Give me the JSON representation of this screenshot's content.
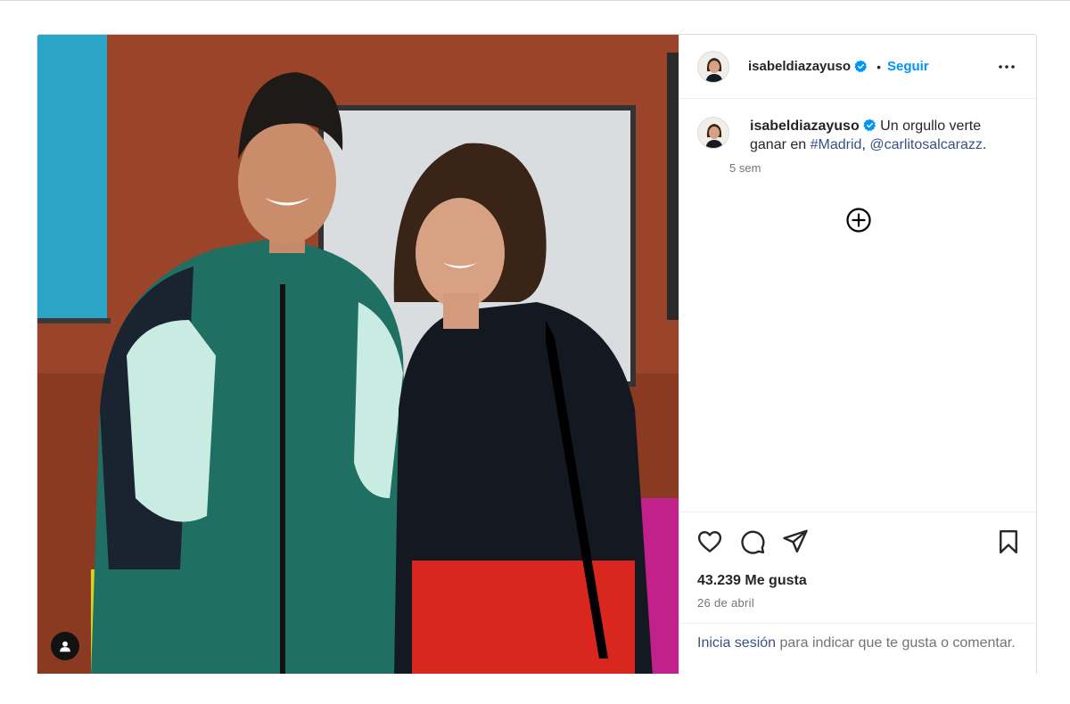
{
  "post": {
    "username": "isabeldiazayuso",
    "follow_label": "Seguir",
    "separator": "•",
    "caption_text": "Un orgullo verte ganar en",
    "hashtag": "#Madrid",
    "comma": ",",
    "mention": "@carlitosalcarazz",
    "period": ".",
    "caption_time": "5 sem",
    "likes": "43.239 Me gusta",
    "date": "26 de abril",
    "login_link": "Inicia sesión",
    "login_text": "para indicar que te gusta o comentar."
  },
  "icons": {
    "verified": "verified-badge-icon",
    "more": "more-options-icon",
    "add": "add-circle-icon",
    "like": "heart-icon",
    "comment": "comment-icon",
    "share": "share-icon",
    "save": "bookmark-icon",
    "tag": "user-tag-icon"
  },
  "colors": {
    "accent": "#0095f6",
    "link": "#385185",
    "verified": "#0095f6"
  }
}
